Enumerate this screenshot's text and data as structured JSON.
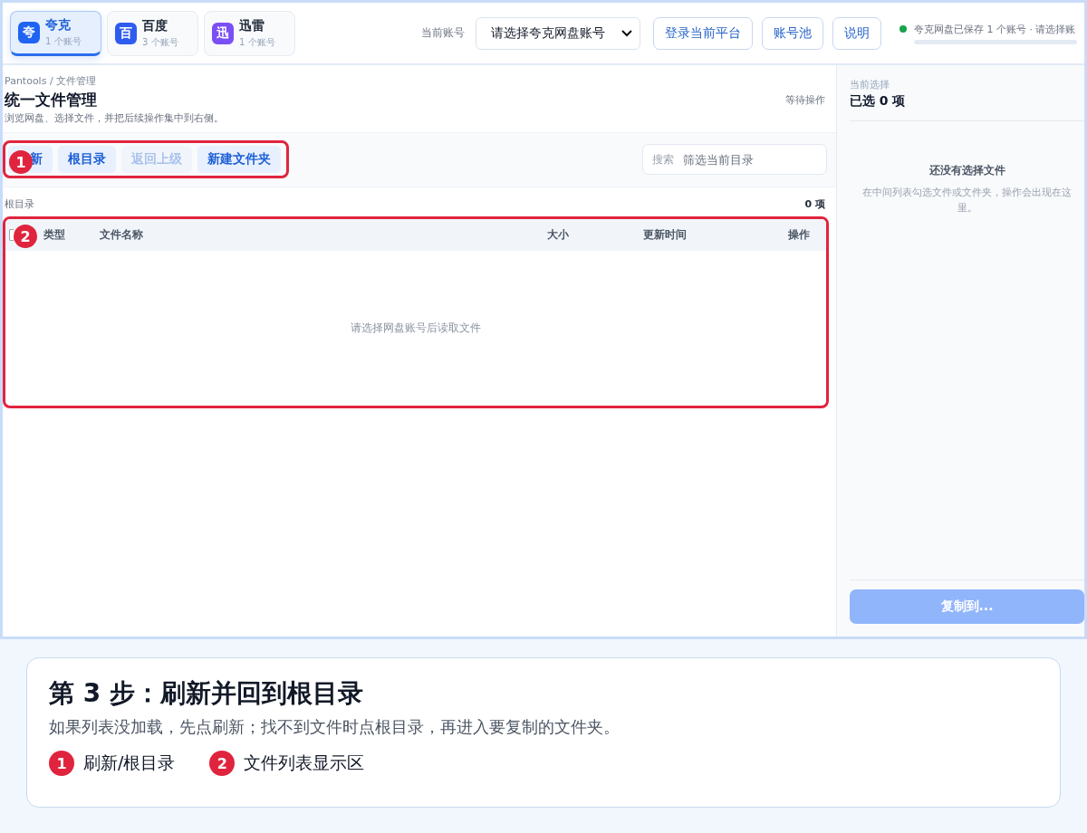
{
  "platforms": [
    {
      "icon": "夸",
      "name": "夸克",
      "count": "1 个账号",
      "selected": true,
      "color": "#1f63f2"
    },
    {
      "icon": "百",
      "name": "百度",
      "count": "3 个账号",
      "selected": false,
      "color": "#2f5cf0"
    },
    {
      "icon": "迅",
      "name": "迅雷",
      "count": "1 个账号",
      "selected": false,
      "color": "#7a4ff5"
    }
  ],
  "account": {
    "label": "当前账号",
    "value": "请选择夸克网盘账号"
  },
  "top_buttons": [
    "登录当前平台",
    "账号池",
    "说明"
  ],
  "status": {
    "text": "夸克网盘已保存 1 个账号 · 请选择账",
    "on": true
  },
  "page": {
    "breadcrumb": "Pantools / 文件管理",
    "title": "统一文件管理",
    "subtitle": "浏览网盘、选择文件，并把后续操作集中到右侧。",
    "state": "等待操作"
  },
  "toolbar": {
    "buttons": [
      {
        "label": "新",
        "disabled": false
      },
      {
        "label": "根目录",
        "disabled": false
      },
      {
        "label": "返回上级",
        "disabled": true
      },
      {
        "label": "新建文件夹",
        "disabled": false
      }
    ],
    "search": {
      "label": "搜索",
      "placeholder": "筛选当前目录"
    }
  },
  "path": {
    "location": "根目录",
    "count": "0 项"
  },
  "table": {
    "select_all": {
      "checked": false
    },
    "columns": [
      "类型",
      "文件名称",
      "大小",
      "更新时间",
      "操作"
    ],
    "empty": "请选择网盘账号后读取文件"
  },
  "selection": {
    "label": "当前选择",
    "count": "已选 0 项",
    "empty_title": "还没有选择文件",
    "empty_text": "在中间列表勾选文件或文件夹，操作会出现在这里。",
    "action": {
      "label": "复制到...",
      "disabled": true
    }
  },
  "callouts": [
    {
      "number": "1"
    },
    {
      "number": "2"
    }
  ],
  "step": {
    "title": "第 3 步：刷新并回到根目录",
    "description": "如果列表没加载，先点刷新；找不到文件时点根目录，再进入要复制的文件夹。",
    "legend": [
      {
        "number": "1",
        "text": "刷新/根目录"
      },
      {
        "number": "2",
        "text": "文件列表显示区"
      }
    ]
  }
}
